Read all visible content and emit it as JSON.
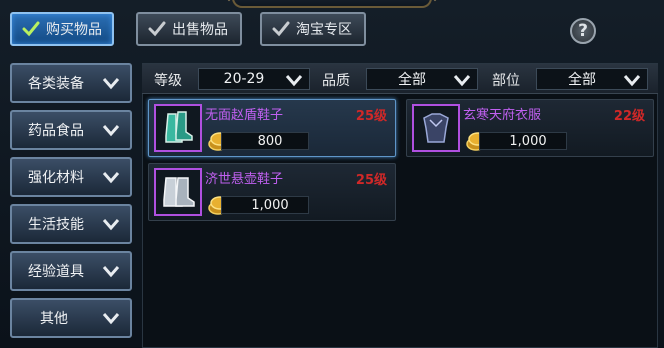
{
  "tabs": [
    {
      "label": "购买物品",
      "active": true
    },
    {
      "label": "出售物品",
      "active": false
    },
    {
      "label": "淘宝专区",
      "active": false
    }
  ],
  "help_label": "?",
  "sidebar": {
    "items": [
      {
        "label": "各类装备"
      },
      {
        "label": "药品食品"
      },
      {
        "label": "强化材料"
      },
      {
        "label": "生活技能"
      },
      {
        "label": "经验道具"
      },
      {
        "label": "其他"
      }
    ]
  },
  "filters": {
    "level_label": "等级",
    "level_value": "20-29",
    "quality_label": "品质",
    "quality_value": "全部",
    "slot_label": "部位",
    "slot_value": "全部"
  },
  "items": [
    {
      "name": "无面赵盾鞋子",
      "level": "25级",
      "price": "800",
      "icon": "boots-green-icon",
      "selected": true
    },
    {
      "name": "玄寒天府衣服",
      "level": "22级",
      "price": "1,000",
      "icon": "armor-dark-icon",
      "selected": false
    },
    {
      "name": "济世悬壶鞋子",
      "level": "25级",
      "price": "1,000",
      "icon": "boots-white-icon",
      "selected": false
    }
  ],
  "colors": {
    "item_name": "#c060f0",
    "item_level": "#d02828",
    "active_tab": "#2b6fb5",
    "rarity_border": "#b050e0"
  }
}
